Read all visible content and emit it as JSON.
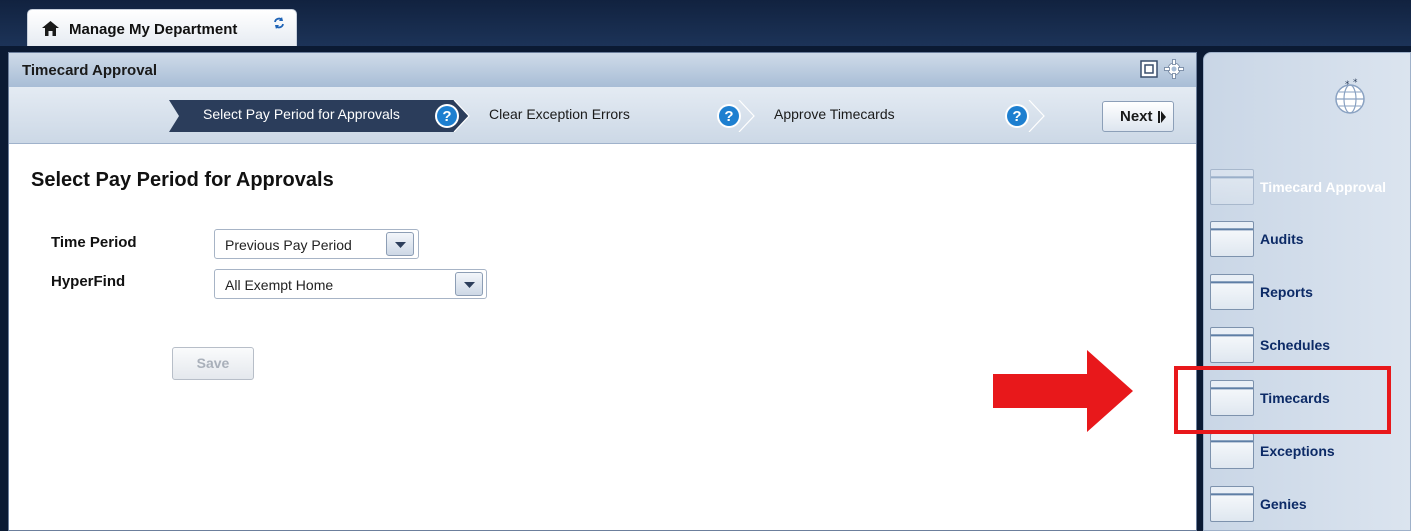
{
  "tab": {
    "label": "Manage My Department",
    "icons": [
      "home-icon",
      "refresh-icon"
    ]
  },
  "panel": {
    "title": "Timecard Approval",
    "header_icons": [
      "window-icon",
      "gear-icon"
    ]
  },
  "wizard": {
    "steps": [
      {
        "label": "Select Pay Period for Approvals",
        "active": true
      },
      {
        "label": "Clear Exception Errors",
        "active": false
      },
      {
        "label": "Approve Timecards",
        "active": false
      }
    ],
    "next_label": "Next"
  },
  "content": {
    "title": "Select Pay Period for Approvals",
    "time_period": {
      "label": "Time Period",
      "value": "Previous Pay Period"
    },
    "hyperfind": {
      "label": "HyperFind",
      "value": "All Exempt Home"
    },
    "save_label": "Save"
  },
  "sidebar": {
    "items": [
      {
        "label": "Timecard Approval",
        "enabled": false
      },
      {
        "label": "Audits",
        "enabled": true
      },
      {
        "label": "Reports",
        "enabled": true
      },
      {
        "label": "Schedules",
        "enabled": true
      },
      {
        "label": "Timecards",
        "enabled": true,
        "highlighted": true
      },
      {
        "label": "Exceptions",
        "enabled": true
      },
      {
        "label": "Genies",
        "enabled": true
      }
    ]
  },
  "colors": {
    "active_step": "#2b3d5b",
    "help_icon": "#1d7fd0",
    "annotation_red": "#e8181b",
    "sidebar_link": "#0c2a66"
  }
}
